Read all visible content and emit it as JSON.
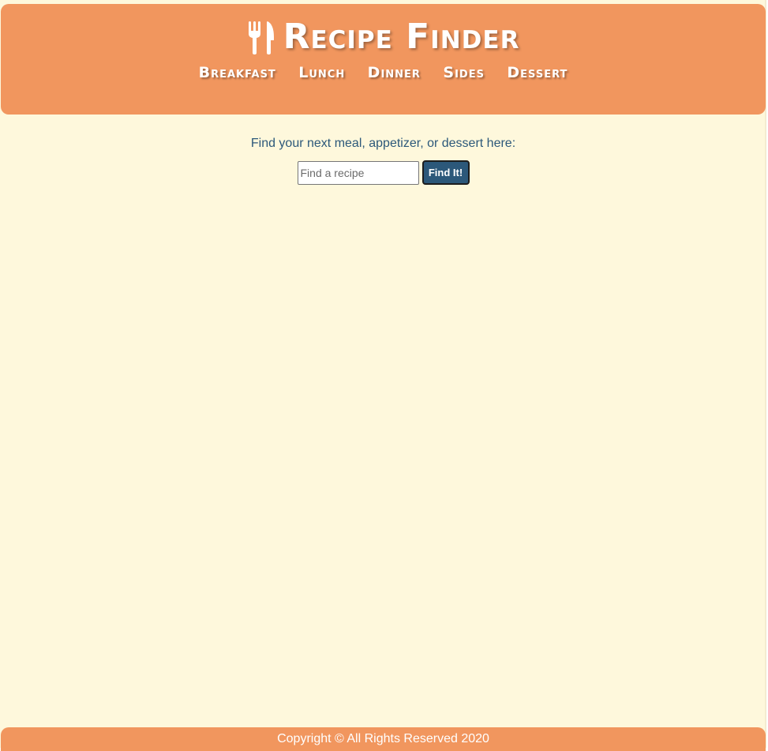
{
  "header": {
    "title": "Recipe Finder",
    "icon": "utensils-icon",
    "nav": [
      {
        "label": "Breakfast"
      },
      {
        "label": "Lunch"
      },
      {
        "label": "Dinner"
      },
      {
        "label": "Sides"
      },
      {
        "label": "Dessert"
      }
    ]
  },
  "main": {
    "intro": "Find your next meal, appetizer, or dessert here:",
    "search": {
      "placeholder": "Find a recipe",
      "value": "",
      "button_label": "Find It!"
    }
  },
  "footer": {
    "copyright": "Copyright © All Rights Reserved 2020"
  },
  "colors": {
    "header_bg": "#f1965e",
    "page_bg": "#fef8dc",
    "accent": "#2c587a",
    "nav_text": "#ffffff"
  }
}
